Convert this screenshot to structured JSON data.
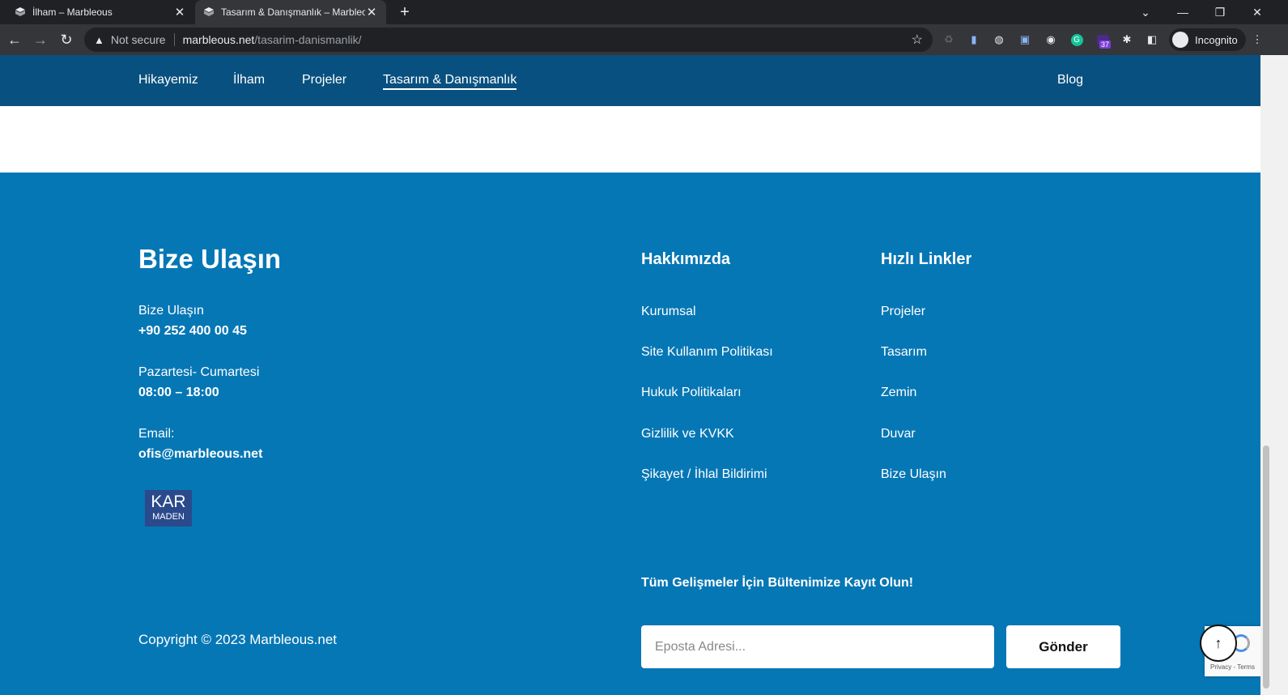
{
  "browser": {
    "tabs": [
      {
        "title": "İlham – Marbleous",
        "active": false
      },
      {
        "title": "Tasarım & Danışmanlık – Marbleous",
        "active": true
      }
    ],
    "address": {
      "security_label": "Not secure",
      "host": "marbleous.net",
      "path": "/tasarim-danismanlik/"
    },
    "extension_badge": "37",
    "profile_label": "Incognito"
  },
  "nav": {
    "items": [
      "Hikayemiz",
      "İlham",
      "Projeler",
      "Tasarım & Danışmanlık"
    ],
    "right_item": "Blog"
  },
  "footer": {
    "contact": {
      "heading": "Bize Ulaşın",
      "phone_label": "Bize Ulaşın",
      "phone": "+90 252 400 00 45",
      "hours_label": "Pazartesi- Cumartesi",
      "hours": "08:00 – 18:00",
      "email_label": "Email:",
      "email": "ofis@marbleous.net"
    },
    "logo": {
      "line1": "KAR",
      "line2": "MADEN"
    },
    "about": {
      "heading": "Hakkımızda",
      "links": [
        "Kurumsal",
        "Site Kullanım Politikası",
        "Hukuk Politikaları",
        "Gizlilik ve KVKK",
        "Şikayet / İhlal Bildirimi"
      ]
    },
    "quick": {
      "heading": "Hızlı Linkler",
      "links": [
        "Projeler",
        "Tasarım",
        "Zemin",
        "Duvar",
        "Bize Ulaşın"
      ]
    },
    "newsletter": {
      "title": "Tüm Gelişmeler İçin Bültenimize Kayıt Olun!",
      "placeholder": "Eposta Adresi...",
      "button": "Gönder"
    },
    "copyright": "Copyright © 2023 Marbleous.net",
    "recaptcha_text": "Privacy - Terms"
  },
  "colors": {
    "nav_bg": "#08507f",
    "footer_bg": "#0677b5"
  }
}
